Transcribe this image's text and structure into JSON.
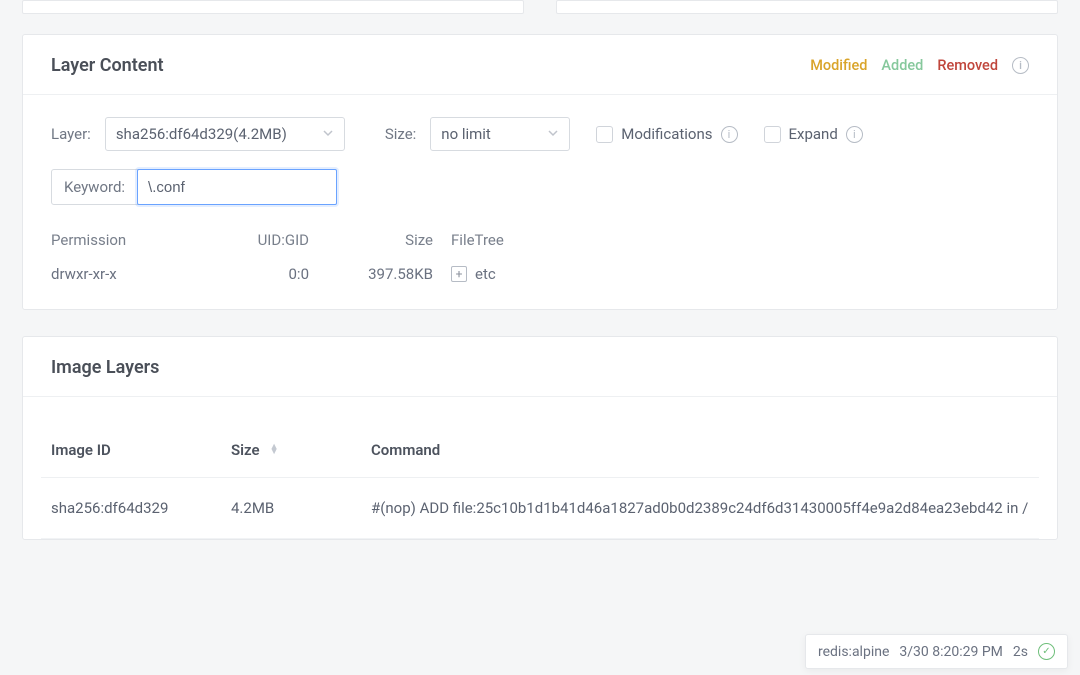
{
  "layerContent": {
    "title": "Layer Content",
    "legend": {
      "modified": "Modified",
      "added": "Added",
      "removed": "Removed"
    },
    "controls": {
      "layerLabel": "Layer:",
      "layerValue": "sha256:df64d329(4.2MB)",
      "sizeLabel": "Size:",
      "sizeValue": "no limit",
      "modifications": "Modifications",
      "expand": "Expand",
      "keywordLabel": "Keyword:",
      "keywordValue": "\\.conf"
    },
    "headers": {
      "permission": "Permission",
      "uidgid": "UID:GID",
      "size": "Size",
      "filetree": "FileTree"
    },
    "rows": [
      {
        "permission": "drwxr-xr-x",
        "uidgid": "0:0",
        "size": "397.58KB",
        "name": "etc"
      }
    ]
  },
  "imageLayers": {
    "title": "Image Layers",
    "headers": {
      "imageId": "Image ID",
      "size": "Size",
      "command": "Command"
    },
    "rows": [
      {
        "imageId": "sha256:df64d329",
        "size": "4.2MB",
        "command": "#(nop) ADD file:25c10b1d1b41d46a1827ad0b0d2389c24df6d31430005ff4e9a2d84ea23ebd42 in /"
      }
    ]
  },
  "toast": {
    "name": "redis:alpine",
    "time": "3/30 8:20:29 PM",
    "duration": "2s"
  }
}
